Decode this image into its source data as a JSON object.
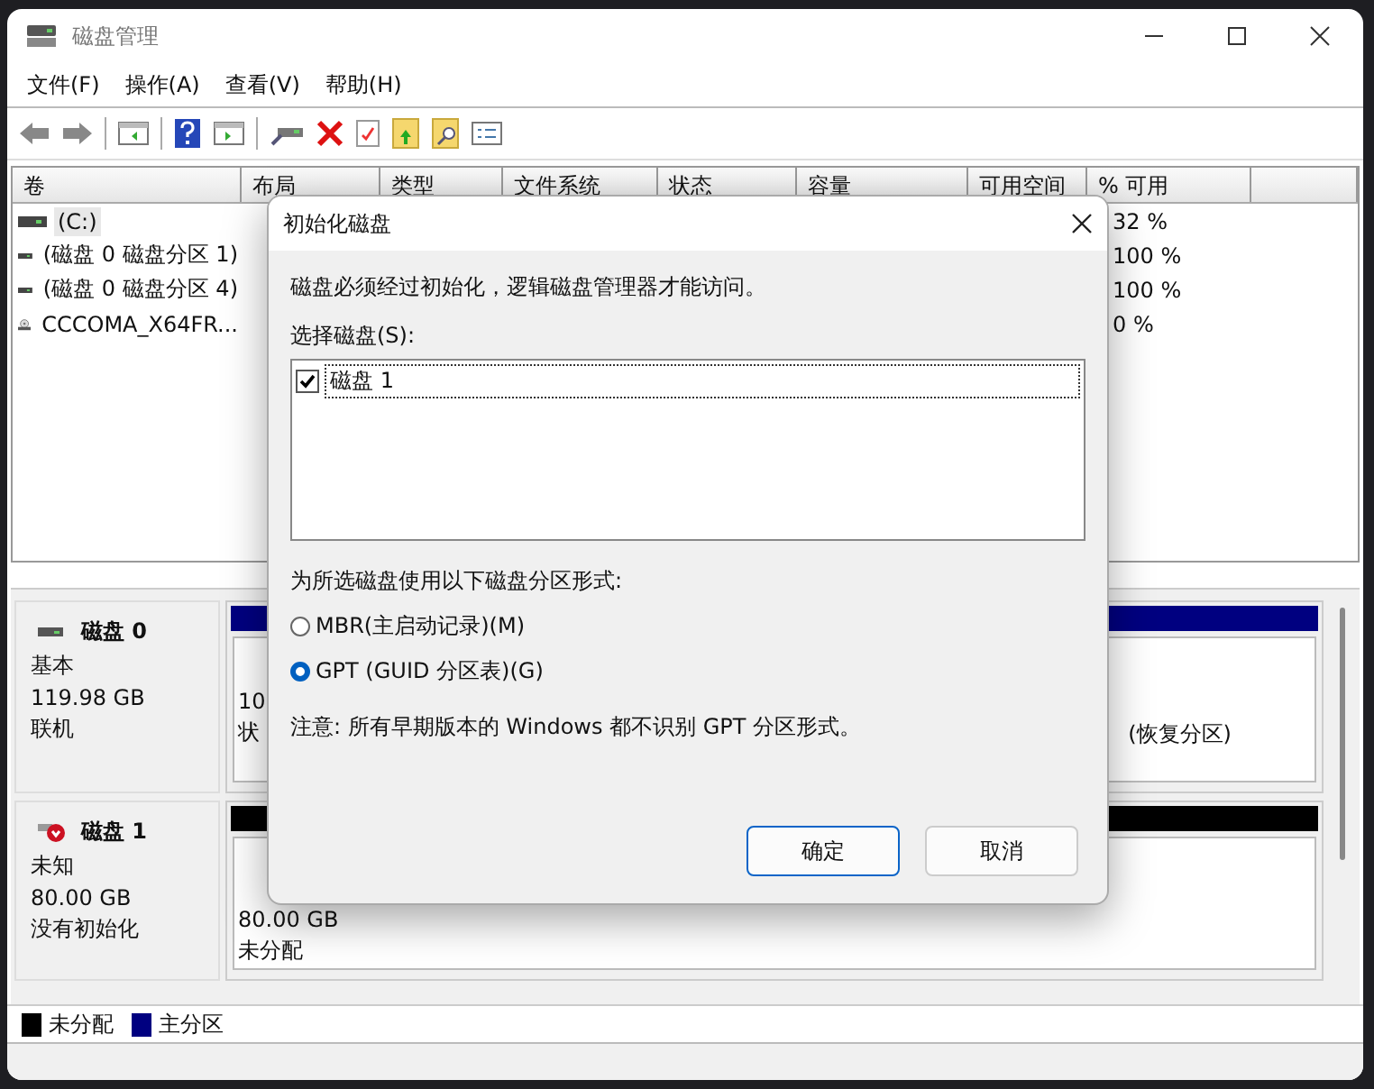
{
  "window": {
    "title": "磁盘管理"
  },
  "menu": [
    "文件(F)",
    "操作(A)",
    "查看(V)",
    "帮助(H)"
  ],
  "volume_table": {
    "columns": [
      "卷",
      "布局",
      "类型",
      "文件系统",
      "状态",
      "容量",
      "可用空间",
      "% 可用"
    ],
    "rows": [
      {
        "volume": "(C:)",
        "kind": "drive",
        "percent_free": "32 %",
        "selected": true
      },
      {
        "volume": "(磁盘 0 磁盘分区 1)",
        "kind": "drive",
        "percent_free": "100 %",
        "selected": false
      },
      {
        "volume": "(磁盘 0 磁盘分区 4)",
        "kind": "drive",
        "percent_free": "100 %",
        "selected": false
      },
      {
        "volume": "CCCOMA_X64FR...",
        "kind": "cdrom",
        "percent_free": "0 %",
        "selected": false
      }
    ]
  },
  "disks": [
    {
      "name": "磁盘 0",
      "kind": "online",
      "type": "基本",
      "size": "119.98 GB",
      "status": "联机",
      "partitions": [
        {
          "kind": "primary",
          "line_1": "10",
          "line_2": "状"
        },
        {
          "kind": "primary",
          "line_2": "(恢复分区)"
        }
      ]
    },
    {
      "name": "磁盘 1",
      "kind": "unknown",
      "type": "未知",
      "size": "80.00 GB",
      "status": "没有初始化",
      "partitions": [
        {
          "kind": "unallocated",
          "line_1": "80.00 GB",
          "line_2": "未分配"
        }
      ]
    }
  ],
  "legend": [
    {
      "label": "未分配",
      "color": "#000000"
    },
    {
      "label": "主分区",
      "color": "#000080"
    }
  ],
  "dialog": {
    "title": "初始化磁盘",
    "message": "磁盘必须经过初始化，逻辑磁盘管理器才能访问。",
    "select_label": "选择磁盘(S):",
    "disks": [
      {
        "label": "磁盘 1",
        "checked": true
      }
    ],
    "style_label": "为所选磁盘使用以下磁盘分区形式:",
    "options": [
      {
        "label": "MBR(主启动记录)(M)",
        "selected": false
      },
      {
        "label": "GPT (GUID 分区表)(G)",
        "selected": true
      }
    ],
    "note": "注意: 所有早期版本的 Windows 都不识别 GPT 分区形式。",
    "buttons": [
      {
        "label": "确定",
        "kind": "default"
      },
      {
        "label": "取消",
        "kind": "normal"
      }
    ]
  }
}
